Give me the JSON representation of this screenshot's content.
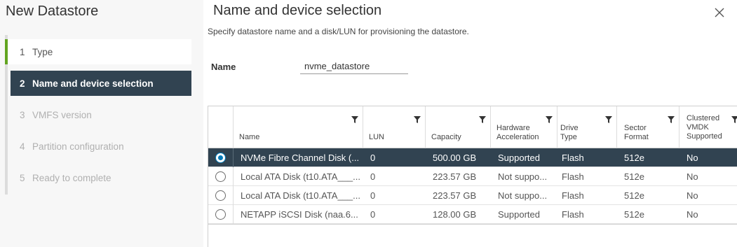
{
  "wizard": {
    "title": "New Datastore",
    "steps": [
      {
        "num": "1",
        "label": "Type",
        "state": "done"
      },
      {
        "num": "2",
        "label": "Name and device selection",
        "state": "active"
      },
      {
        "num": "3",
        "label": "VMFS version",
        "state": "todo"
      },
      {
        "num": "4",
        "label": "Partition configuration",
        "state": "todo"
      },
      {
        "num": "5",
        "label": "Ready to complete",
        "state": "todo"
      }
    ]
  },
  "page": {
    "title": "Name and device selection",
    "subtitle": "Specify datastore name and a disk/LUN for provisioning the datastore.",
    "close_icon": "close-icon"
  },
  "form": {
    "name_label": "Name",
    "name_value": "nvme_datastore"
  },
  "grid": {
    "columns": [
      {
        "key": "name",
        "label": "Name"
      },
      {
        "key": "lun",
        "label": "LUN"
      },
      {
        "key": "capacity",
        "label": "Capacity"
      },
      {
        "key": "hw_accel",
        "label": "Hardware Acceleration"
      },
      {
        "key": "drive_type",
        "label": "Drive Type"
      },
      {
        "key": "sector_format",
        "label": "Sector Format"
      },
      {
        "key": "clustered_vmdk",
        "label": "Clustered VMDK Supported"
      }
    ],
    "rows": [
      {
        "selected": true,
        "name": "NVMe Fibre Channel Disk (...",
        "lun": "0",
        "capacity": "500.00 GB",
        "hw_accel": "Supported",
        "drive_type": "Flash",
        "sector_format": "512e",
        "clustered_vmdk": "No"
      },
      {
        "selected": false,
        "name": "Local ATA Disk (t10.ATA___...",
        "lun": "0",
        "capacity": "223.57 GB",
        "hw_accel": "Not suppo...",
        "drive_type": "Flash",
        "sector_format": "512e",
        "clustered_vmdk": "No"
      },
      {
        "selected": false,
        "name": "Local ATA Disk (t10.ATA___...",
        "lun": "0",
        "capacity": "223.57 GB",
        "hw_accel": "Not suppo...",
        "drive_type": "Flash",
        "sector_format": "512e",
        "clustered_vmdk": "No"
      },
      {
        "selected": false,
        "name": "NETAPP iSCSI Disk (naa.6...",
        "lun": "0",
        "capacity": "128.00 GB",
        "hw_accel": "Supported",
        "drive_type": "Flash",
        "sector_format": "512e",
        "clustered_vmdk": "No"
      }
    ]
  },
  "colors": {
    "active_step_bg": "#314351",
    "done_step_accent": "#62a420",
    "radio_selected": "#0079b8"
  }
}
